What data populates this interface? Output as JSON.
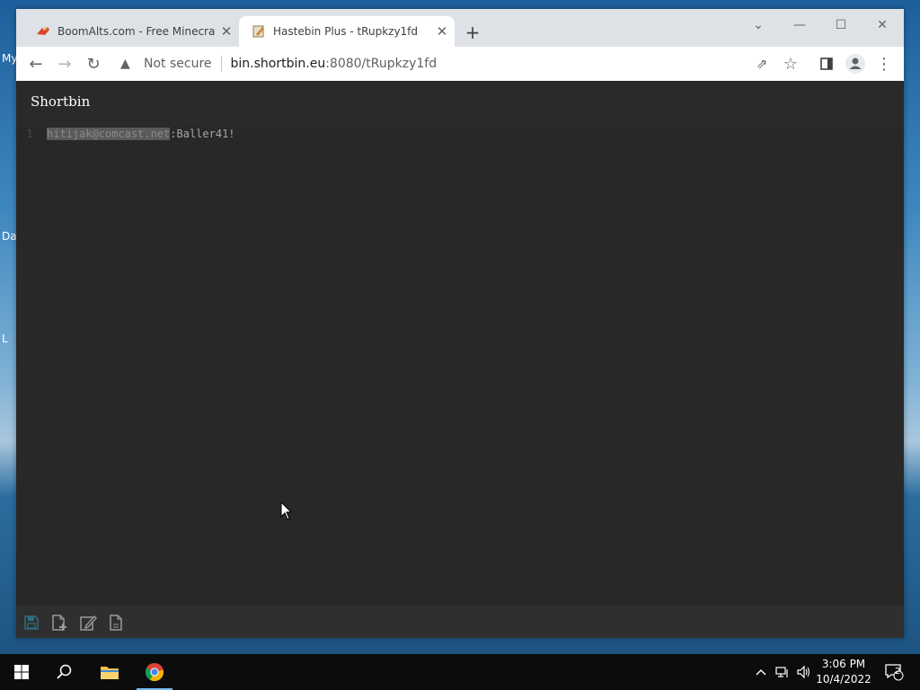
{
  "desktop": {
    "labels": [
      "My",
      "Da",
      "L"
    ]
  },
  "browser": {
    "tabs": [
      {
        "title": "BoomAlts.com - Free Minecraft A",
        "favicon": "boomalts-favicon",
        "active": false
      },
      {
        "title": "Hastebin Plus - tRupkzy1fd",
        "favicon": "hastebin-favicon",
        "active": true
      }
    ],
    "new_tab_label": "+",
    "security_text": "Not secure",
    "url_host": "bin.shortbin.eu",
    "url_path": ":8080/tRupkzy1fd"
  },
  "page": {
    "brand": "Shortbin",
    "lines": [
      {
        "number": "1",
        "selected": "hitijak@comcast.net",
        "rest": ":Baller41!"
      }
    ],
    "actions": [
      "save-icon",
      "new-document-icon",
      "edit-icon",
      "raw-file-icon"
    ]
  },
  "taskbar": {
    "time": "3:06 PM",
    "date": "10/4/2022",
    "notification_count": "2"
  },
  "colors": {
    "editor_bg": "#282828",
    "header_bg": "#2a2a2a",
    "selection": "#5a5a5a",
    "accent_save": "#2a6f82",
    "taskbar_indicator": "#76b9ed"
  }
}
